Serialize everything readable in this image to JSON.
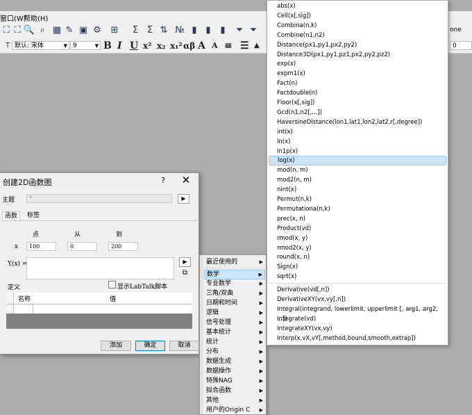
{
  "menubar": {
    "window": "窗口(W)",
    "help": "帮助(H)"
  },
  "toolbar": {
    "right_label": "one",
    "font_name": "默认: 宋体",
    "font_size": "9",
    "zero_value": "0",
    "bold": "B",
    "italic": "I",
    "underline": "U",
    "superscript": "x²",
    "subscript": "x₂",
    "supersub": "x₁²",
    "greek": "αβ",
    "grow_font": "A",
    "shrink_font": "A"
  },
  "dialog": {
    "title": "创建2D函数图",
    "help": "?",
    "close": "✕",
    "theme_label": "主题",
    "theme_value": "*",
    "tabs": [
      "函数",
      "标签"
    ],
    "col_point": "点",
    "col_from": "从",
    "col_to": "到",
    "x_label": "x",
    "x_points": "100",
    "x_from": "0",
    "x_to": "200",
    "y_label": "Y(x) =",
    "y_value": "",
    "define_label": "定义",
    "show_script": "显示LabTalk脚本",
    "grid_col_name": "名称",
    "grid_col_value": "值",
    "btn_add": "添加",
    "btn_ok": "确定",
    "btn_cancel": "取消"
  },
  "category_menu": [
    "最近使用的",
    "数学",
    "专业数学",
    "三角/双曲",
    "日期和时间",
    "逻辑",
    "信号处理",
    "基本统计",
    "统计",
    "分布",
    "数据生成",
    "数据操作",
    "特殊NAG",
    "拟合函数",
    "其他",
    "用户的Origin C"
  ],
  "category_selected": "数学",
  "function_menu": [
    "abs(x)",
    "Ceil(x[,sig])",
    "Combina(n,k)",
    "Combine(n1,n2)",
    "Distance(px1,py1,px2,py2)",
    "Distance3D(px1,py1,pz1,px2,py2,pz2)",
    "exp(x)",
    "expm1(x)",
    "Fact(n)",
    "Factdouble(n)",
    "Floor(x[,sig])",
    "Gcd(n1,n2[,...])",
    "HaversineDistance(lon1,lat1,lon2,lat2,r[,degree])",
    "int(x)",
    "ln(x)",
    "ln1p(x)",
    "log(x)",
    "mod(n, m)",
    "mod2(n, m)",
    "nint(x)",
    "Permut(n,k)",
    "Permutationa(n,k)",
    "prec(x, n)",
    "Product(vd)",
    "rmod(x, y)",
    "rmod2(x, y)",
    "round(x, n)",
    "Sign(x)",
    "sqrt(x)",
    "Derivative(vd[,n])",
    "DerivativeXY(vx,vy[,n])",
    "Integral(integrand, lowerlimit, upperlimit [, arg1, arg2, ...])",
    "Integrate(vd)",
    "IntegrateXY(vx,vy)",
    "Interp(x,vX,vY[,method,bound,smooth,extrap])"
  ],
  "function_selected": "log(x)"
}
